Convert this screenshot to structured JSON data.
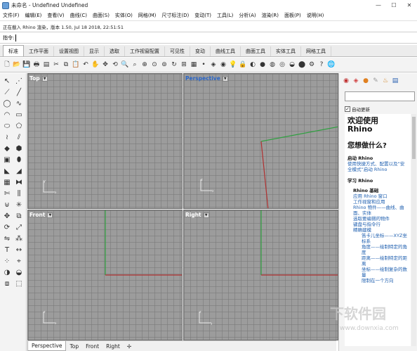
{
  "window": {
    "title": "未命名 - Undefined Undefined",
    "minimize": "—",
    "maximize": "☐",
    "close": "✕"
  },
  "menu": [
    "文件(F)",
    "编辑(E)",
    "查看(V)",
    "曲线(C)",
    "曲面(S)",
    "实体(O)",
    "网格(M)",
    "尺寸标注(D)",
    "变动(T)",
    "工具(L)",
    "分析(A)",
    "渲染(R)",
    "面板(P)",
    "说明(H)"
  ],
  "command": {
    "history": "正在載入 Rhino 渲染，版本 1.50, Jul 18 2018, 22:51:51",
    "prompt": "指令:",
    "value": ""
  },
  "tabs": [
    {
      "label": "标准",
      "active": true
    },
    {
      "label": "工作平面",
      "active": false
    },
    {
      "label": "设置视图",
      "active": false
    },
    {
      "label": "显示",
      "active": false
    },
    {
      "label": "选取",
      "active": false
    },
    {
      "label": "工作视窗配置",
      "active": false
    },
    {
      "label": "可见性",
      "active": false
    },
    {
      "label": "变动",
      "active": false
    },
    {
      "label": "曲线工具",
      "active": false
    },
    {
      "label": "曲面工具",
      "active": false
    },
    {
      "label": "实体工具",
      "active": false
    },
    {
      "label": "网格工具",
      "active": false
    }
  ],
  "viewports": {
    "top": {
      "label": "Top"
    },
    "perspective": {
      "label": "Perspective"
    },
    "front": {
      "label": "Front"
    },
    "right": {
      "label": "Right"
    }
  },
  "bottom_tabs": [
    {
      "label": "Perspective",
      "active": true
    },
    {
      "label": "Top",
      "active": false
    },
    {
      "label": "Front",
      "active": false
    },
    {
      "label": "Right",
      "active": false
    },
    {
      "label": "✢",
      "active": false
    }
  ],
  "right_panel": {
    "auto_update": "自动更新",
    "welcome": "欢迎使用",
    "product": "Rhino",
    "what_to_do": "您想做什么?",
    "start_section": "启动 Rhino",
    "start_link": "使用快捷方式、配置以及“安全模式”启动 Rhino",
    "learn_section": "学习 Rhino",
    "basics": "Rhino 基础",
    "basics_links": [
      "应用 Rhino 窗口",
      "工作视窗和应用",
      "Rhino 物件——曲线、曲面、实体",
      "选取要编辑的物件",
      "键盘与指令行",
      "精确建模"
    ],
    "precise_links": [
      "笛卡儿坐标——XYZ坐标系",
      "角度——绘制特定的角度",
      "距离——绘制特定的距离",
      "坐标——绘制复杂的数量",
      "限制在一个方向"
    ]
  },
  "watermark": {
    "text": "下软件园",
    "url": "www.downxia.com"
  }
}
